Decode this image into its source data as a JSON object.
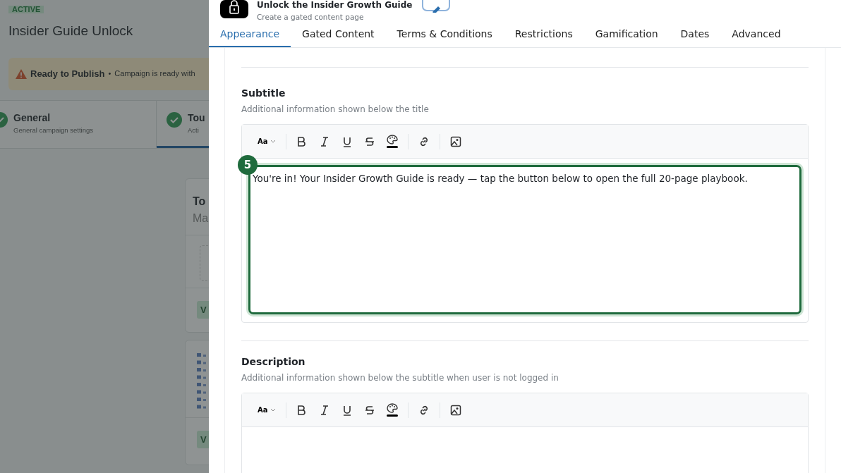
{
  "background": {
    "status_badge": "ACTIVE",
    "title": "Insider Guide Unlock",
    "alert": {
      "title": "Ready to Publish",
      "separator": "•",
      "message": "Campaign is ready with"
    },
    "steps": [
      {
        "title": "General",
        "subtitle": "General campaign settings",
        "done": true,
        "selected": false
      },
      {
        "title": "Tou",
        "subtitle": "Acti",
        "done": true,
        "selected": true
      }
    ],
    "cards": [
      {
        "kind": "text",
        "title": "To",
        "subtitle": "Ma",
        "button": "V"
      },
      {
        "kind": "pattern",
        "button": "V"
      }
    ]
  },
  "panel": {
    "title": "Unlock the Insider Growth Guide",
    "subtitle": "Create a gated content page",
    "tabs": [
      {
        "label": "Appearance",
        "selected": true
      },
      {
        "label": "Gated Content",
        "selected": false
      },
      {
        "label": "Terms & Conditions",
        "selected": false
      },
      {
        "label": "Restrictions",
        "selected": false
      },
      {
        "label": "Gamification",
        "selected": false
      },
      {
        "label": "Dates",
        "selected": false
      },
      {
        "label": "Advanced",
        "selected": false
      }
    ],
    "fields": [
      {
        "label": "Subtitle",
        "help": "Additional information shown below the title",
        "size_label": "Aa",
        "value": "You're in! Your Insider Growth Guide is ready — tap the button below to open the full 20-page playbook.",
        "highlighted": true,
        "step": "5"
      },
      {
        "label": "Description",
        "help": "Additional information shown below the subtitle when user is not logged in",
        "size_label": "Aa",
        "highlighted": false
      }
    ]
  }
}
